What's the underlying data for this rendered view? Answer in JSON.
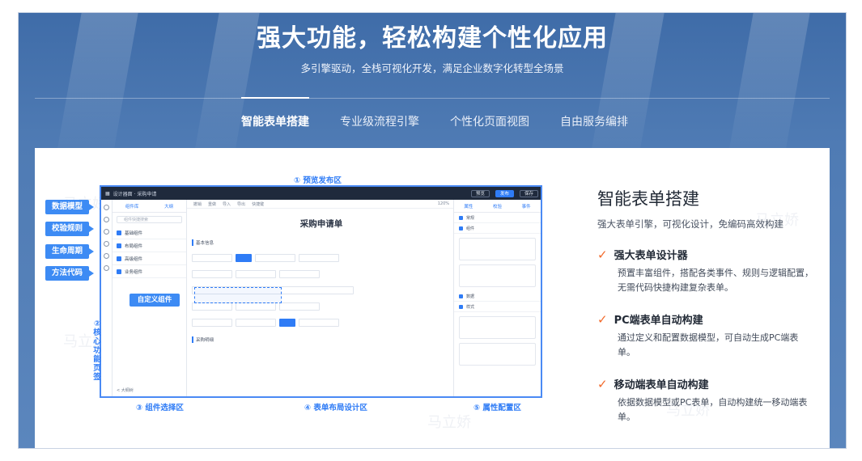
{
  "hero": {
    "title": "强大功能，轻松构建个性化应用",
    "subtitle": "多引擎驱动，全栈可视化开发，满足企业数字化转型全场景"
  },
  "tabs": [
    {
      "label": "智能表单搭建",
      "active": true
    },
    {
      "label": "专业级流程引擎",
      "active": false
    },
    {
      "label": "个性化页面视图",
      "active": false
    },
    {
      "label": "自由服务编排",
      "active": false
    }
  ],
  "watermark": "马立娇",
  "screenshot": {
    "zone1": "① 预览发布区",
    "zone2": "② 核心功能页签",
    "zone3": "③ 组件选择区",
    "zone4": "④ 表单布局设计区",
    "zone5": "⑤ 属性配置区",
    "side_tags": [
      "数据模型",
      "校验规则",
      "生命周期",
      "方法代码"
    ],
    "custom_tag": "自定义组件",
    "form_title": "采购申请单",
    "app_bar": "设计器面 · 采购申请",
    "top_buttons": [
      "预览",
      "发布",
      "保存"
    ],
    "left_tabs": [
      "组件库",
      "大纲"
    ],
    "left_search": "组件快捷搜索",
    "left_items": [
      "基础组件",
      "布局组件",
      "高级组件",
      "业务组件"
    ],
    "left_footer": "< 大纲树",
    "canvas_tools": [
      "撤销",
      "重做",
      "导入",
      "导出",
      "快捷键"
    ],
    "zoom": "120%",
    "sections": [
      "基本信息",
      "采购明细"
    ],
    "right_tabs": [
      "属性",
      "校验",
      "事件"
    ],
    "right_items": [
      "常规",
      "组件",
      "数据",
      "样式"
    ]
  },
  "description": {
    "title": "智能表单搭建",
    "lead": "强大表单引擎，可视化设计，免编码高效构建",
    "features": [
      {
        "heading": "强大表单设计器",
        "text": "预置丰富组件，搭配各类事件、规则与逻辑配置，无需代码快捷构建复杂表单。"
      },
      {
        "heading": "PC端表单自动构建",
        "text": "通过定义和配置数据模型，可自动生成PC端表单。"
      },
      {
        "heading": "移动端表单自动构建",
        "text": "依据数据模型或PC表单，自动构建统一移动端表单。"
      }
    ]
  },
  "colors": {
    "accent": "#2f7cf6",
    "check": "#f26a2b",
    "hero_bg": "#4a76b0"
  }
}
